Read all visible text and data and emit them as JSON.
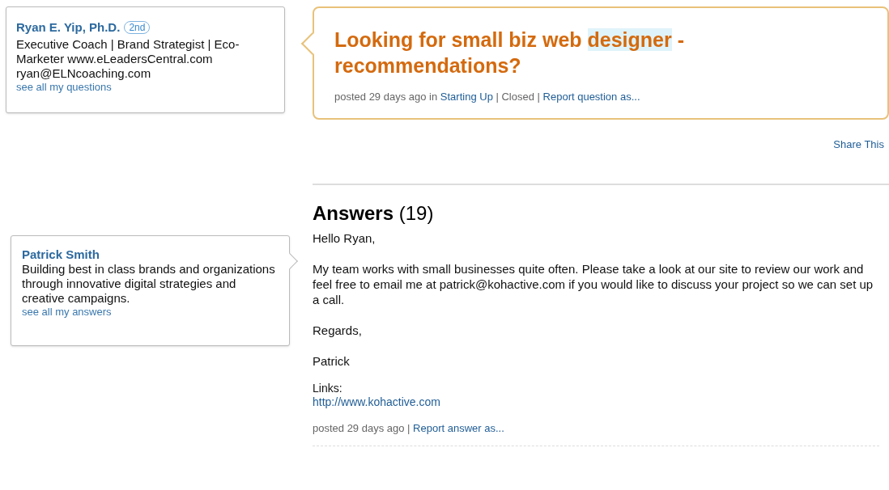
{
  "asker": {
    "name": "Ryan E. Yip, Ph.D.",
    "degree": "2nd",
    "headline": "Executive Coach | Brand Strategist | Eco-Marketer www.eLeadersCentral.com ryan@ELNcoaching.com",
    "link": "see all my questions"
  },
  "question": {
    "title": [
      {
        "text": "Looking for small biz web ",
        "highlighted": false
      },
      {
        "text": "designer",
        "highlighted": true
      },
      {
        "text": " - recommendations?",
        "highlighted": false
      }
    ],
    "meta": [
      {
        "kind": "text",
        "text": "posted 29 days ago in "
      },
      {
        "kind": "link",
        "text": "Starting Up"
      },
      {
        "kind": "text",
        "text": " | Closed | "
      },
      {
        "kind": "link",
        "text": "Report question as..."
      }
    ]
  },
  "share": "Share This",
  "answers_heading": {
    "label": "Answers",
    "count": "(19)"
  },
  "answerer": {
    "name": "Patrick Smith",
    "headline": "Building best in class brands and organizations through innovative digital strategies and creative campaigns.",
    "link": "see all my answers"
  },
  "answer": {
    "paragraphs": [
      "Hello Ryan,",
      "My team works with small businesses quite often. Please take a look at our site to review our work and feel free to email me at patrick@kohactive.com if you would like to discuss your project so we can set up a call.",
      "Regards,",
      "Patrick"
    ],
    "links_label": "Links:",
    "links": [
      "http://www.kohactive.com"
    ],
    "meta": [
      {
        "kind": "text",
        "text": "posted 29 days ago | "
      },
      {
        "kind": "link",
        "text": "Report answer as..."
      }
    ]
  }
}
